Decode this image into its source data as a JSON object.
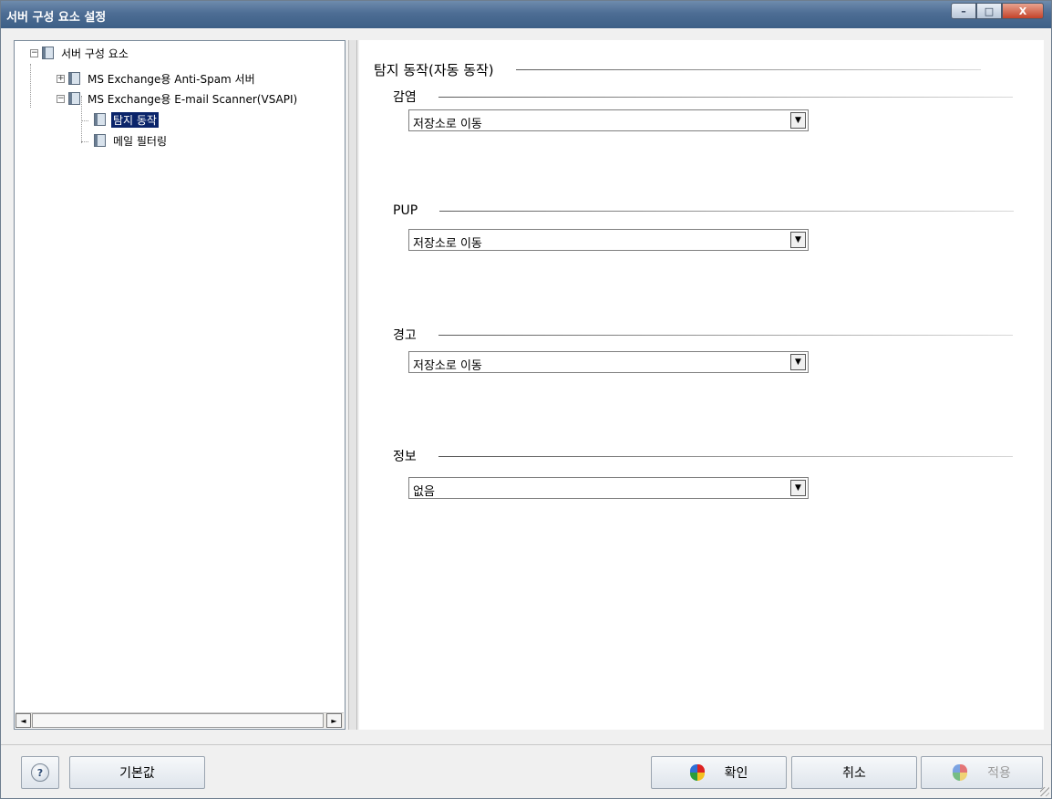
{
  "window": {
    "title": "서버 구성 요소 설정",
    "controls": {
      "minimize": "–",
      "maximize": "□",
      "close": "X"
    }
  },
  "tree": {
    "items": [
      {
        "label": "서버 구성 요소",
        "expander": "−",
        "selected": false
      },
      {
        "label": "MS Exchange용 Anti-Spam 서버",
        "expander": "+",
        "selected": false
      },
      {
        "label": "MS Exchange용 E-mail Scanner(VSAPI)",
        "expander": "−",
        "selected": false
      },
      {
        "label": "탐지 동작",
        "expander": "",
        "selected": true
      },
      {
        "label": "메일 필터링",
        "expander": "",
        "selected": false
      }
    ],
    "scroll": {
      "left": "◄",
      "right": "►"
    }
  },
  "main": {
    "section_title": "탐지 동작(자동 동작)",
    "groups": [
      {
        "label": "감염",
        "value": "저장소로 이동"
      },
      {
        "label": "PUP",
        "value": "저장소로 이동"
      },
      {
        "label": "경고",
        "value": "저장소로 이동"
      },
      {
        "label": "정보",
        "value": "없음"
      }
    ],
    "dropdown_arrow": "▼"
  },
  "footer": {
    "help": "?",
    "default_label": "기본값",
    "ok_label": "확인",
    "cancel_label": "취소",
    "apply_label": "적용"
  },
  "colors": {
    "selection": "#0a246a",
    "titlebar": "#4d6d94"
  }
}
